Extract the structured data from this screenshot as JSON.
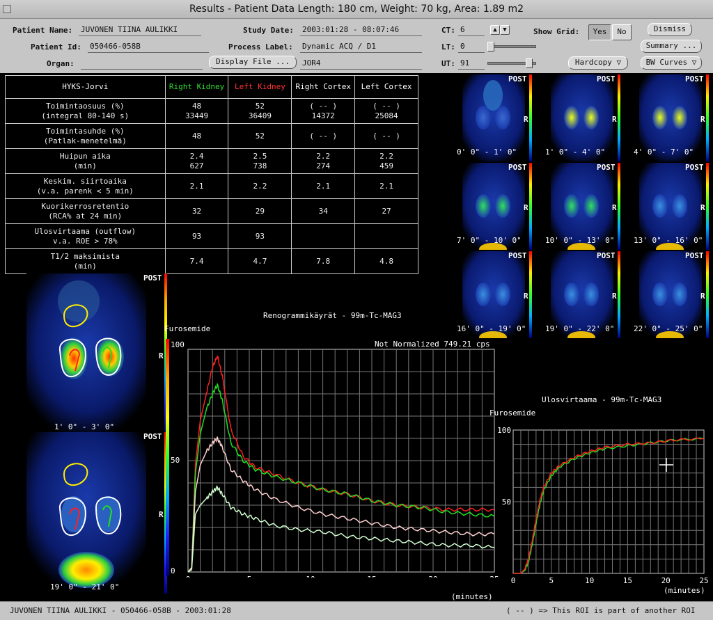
{
  "window": {
    "title": "Results - Patient Data Length: 180 cm, Weight: 70 kg, Area: 1.89 m2"
  },
  "patient": {
    "name_label": "Patient Name:",
    "name": "JUVONEN TIINA AULIKKI",
    "id_label": "Patient Id:",
    "id": "050466-058B",
    "organ_label": "Organ:",
    "organ": ""
  },
  "study": {
    "date_label": "Study Date:",
    "date": "2003:01:28 - 08:07:46",
    "process_label": "Process Label:",
    "process": "Dynamic ACQ / D1",
    "display_file_label": "Display File ...",
    "display_file": "JOR4"
  },
  "levels": {
    "ct_label": "CT:",
    "ct": "6",
    "lt_label": "LT:",
    "lt": "0",
    "ut_label": "UT:",
    "ut": "91",
    "ct_fraction": 0.07,
    "lt_fraction": 0.0,
    "ut_fraction": 0.91
  },
  "show_grid": {
    "label": "Show Grid:",
    "yes": "Yes",
    "no": "No",
    "selected": "Yes"
  },
  "buttons": {
    "dismiss": "Dismiss",
    "summary": "Summary ...",
    "hardcopy": "Hardcopy",
    "bw_curves": "BW Curves"
  },
  "table": {
    "header": [
      "HYKS-Jorvi",
      "Right Kidney",
      "Left Kidney",
      "Right Cortex",
      "Left Cortex"
    ],
    "header_colors": [
      "#ffffff",
      "#33dd33",
      "#ff3333",
      "#ffffff",
      "#ffffff"
    ],
    "rows": [
      {
        "l1": "Toimintaosuus (%)",
        "l2": "(integral 80-140 s)",
        "v": [
          [
            "48",
            "33449"
          ],
          [
            "52",
            "36409"
          ],
          [
            "( -- )",
            "14372"
          ],
          [
            "( -- )",
            "25084"
          ]
        ]
      },
      {
        "l1": "Toimintasuhde (%)",
        "l2": "(Patlak-menetelmä)",
        "v": [
          [
            "48"
          ],
          [
            "52"
          ],
          [
            "( -- )"
          ],
          [
            "( -- )"
          ]
        ]
      },
      {
        "l1": "Huipun aika",
        "l2": "(min)",
        "v": [
          [
            "2.4",
            "627"
          ],
          [
            "2.5",
            "738"
          ],
          [
            "2.2",
            "274"
          ],
          [
            "2.2",
            "459"
          ]
        ]
      },
      {
        "l1": "Keskim. siirtoaika",
        "l2": "(v.a. parenk < 5 min)",
        "v": [
          [
            "2.1"
          ],
          [
            "2.2"
          ],
          [
            "2.1"
          ],
          [
            "2.1"
          ]
        ]
      },
      {
        "l1": "Kuorikerrosretentio",
        "l2": "(RCA% at 24 min)",
        "v": [
          [
            "32"
          ],
          [
            "29"
          ],
          [
            "34"
          ],
          [
            "27"
          ]
        ]
      },
      {
        "l1": "Ulosvirtaama (outflow)",
        "l2": "v.a. ROE > 78%",
        "v": [
          [
            "93"
          ],
          [
            "93"
          ],
          [
            ""
          ],
          [
            ""
          ]
        ]
      },
      {
        "l1": "T1/2 maksimista",
        "l2": "(min)",
        "v": [
          [
            "7.4"
          ],
          [
            "4.7"
          ],
          [
            "7.8"
          ],
          [
            "4.8"
          ]
        ]
      }
    ]
  },
  "thumbnails": {
    "post": "POST",
    "r": "R",
    "captions": [
      "0' 0\" - 1' 0\"",
      "1' 0\" - 4' 0\"",
      "4' 0\" - 7' 0\"",
      "7' 0\" - 10' 0\"",
      "10' 0\" - 13' 0\"",
      "13' 0\" - 16' 0\"",
      "16' 0\" - 19' 0\"",
      "19' 0\" - 22' 0\"",
      "22' 0\" - 25' 0\""
    ]
  },
  "roi_images": {
    "post": "POST",
    "r": "R",
    "top_caption": "1' 0\" - 3' 0\"",
    "bottom_caption": "19' 0\" - 21' 0\""
  },
  "colorbar": {
    "labels": [
      "100",
      "50",
      "0"
    ]
  },
  "chart_data": [
    {
      "type": "line",
      "title": "Renogrammikäyrät - 99m-Tc-MAG3",
      "subtitle": "Not Normalized 749.21 cps",
      "annotation": "Furosemide",
      "xlabel": "(minutes)",
      "xlim": [
        0,
        25
      ],
      "ylim": [
        0,
        100
      ],
      "x_ticks": [
        0,
        5,
        10,
        15,
        20,
        25
      ],
      "grid": true,
      "x": [
        0,
        0.3,
        0.6,
        1.0,
        1.5,
        2.0,
        2.4,
        2.8,
        3.5,
        4.5,
        5.5,
        7,
        9,
        11,
        13,
        15,
        17,
        19,
        21,
        23,
        25
      ],
      "series": [
        {
          "color": "#ff2020",
          "values": [
            0,
            2,
            48,
            68,
            80,
            92,
            97,
            88,
            64,
            52,
            47,
            44,
            40,
            37,
            35,
            32,
            30,
            29,
            28,
            28,
            28
          ]
        },
        {
          "color": "#20e020",
          "values": [
            0,
            2,
            44,
            62,
            73,
            80,
            84,
            77,
            58,
            50,
            46,
            43,
            40,
            37,
            35,
            32,
            30,
            29,
            27,
            26,
            25
          ]
        },
        {
          "color": "#ffd0d0",
          "values": [
            0,
            2,
            36,
            48,
            54,
            58,
            60,
            56,
            46,
            41,
            37,
            33,
            29,
            26,
            24,
            22,
            20,
            19,
            18,
            17,
            17
          ]
        },
        {
          "color": "#d0ffd0",
          "values": [
            0,
            1,
            26,
            30,
            33,
            36,
            38,
            35,
            29,
            26,
            24,
            21,
            19,
            18,
            16,
            15,
            14,
            13,
            12,
            12,
            11
          ]
        }
      ]
    },
    {
      "type": "line",
      "title": "Ulosvirtaama - 99m-Tc-MAG3",
      "annotation": "Furosemide",
      "xlabel": "(minutes)",
      "xlim": [
        0,
        25
      ],
      "ylim": [
        0,
        100
      ],
      "x_ticks": [
        0,
        5,
        10,
        15,
        20,
        25
      ],
      "y_ticks": [
        50,
        100
      ],
      "grid": true,
      "x": [
        0,
        1,
        1.5,
        2,
        2.5,
        3,
        3.5,
        4,
        5,
        6,
        8,
        10,
        12,
        15,
        18,
        21,
        25
      ],
      "series": [
        {
          "color": "#20e020",
          "values": [
            0,
            0,
            2,
            8,
            20,
            35,
            48,
            58,
            68,
            74,
            80,
            84,
            87,
            89,
            91,
            93,
            94
          ]
        },
        {
          "color": "#ff2020",
          "values": [
            0,
            0,
            3,
            10,
            23,
            38,
            51,
            60,
            70,
            75,
            81,
            85,
            88,
            90,
            91,
            93,
            94
          ]
        }
      ]
    }
  ],
  "status_bar": {
    "left": "JUVONEN TIINA AULIKKI - 050466-058B - 2003:01:28",
    "right": "( -- ) => This ROI is part of another ROI"
  }
}
